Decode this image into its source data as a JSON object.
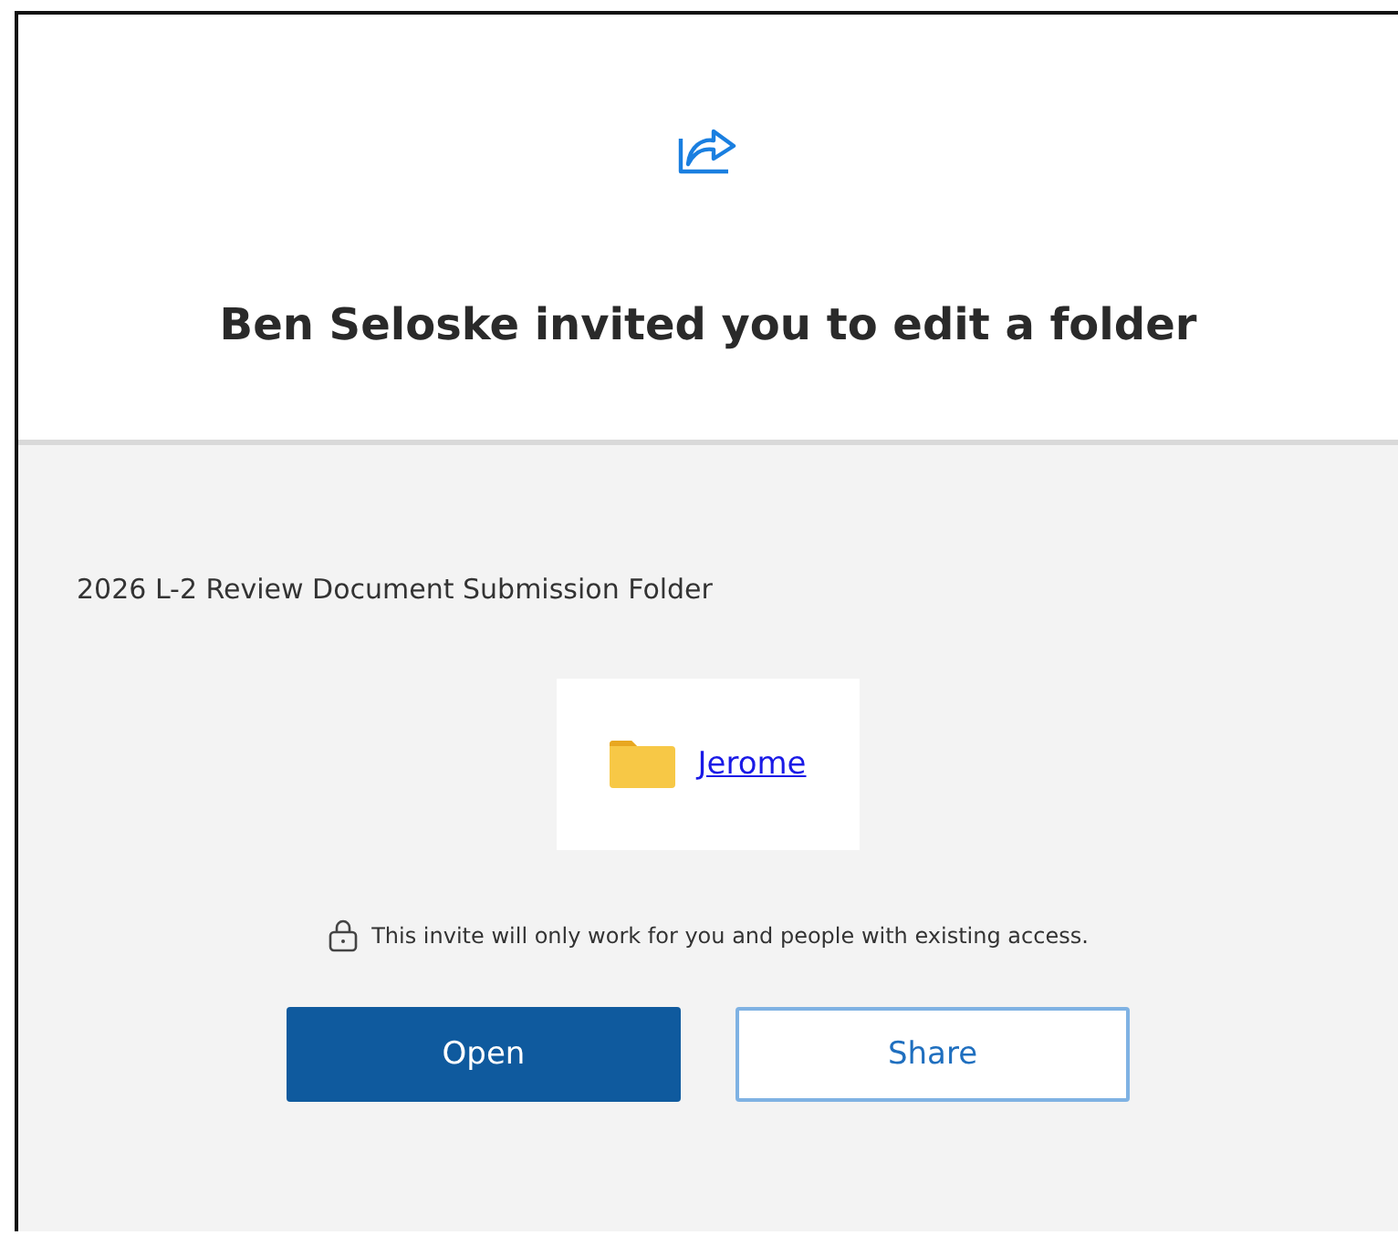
{
  "header": {
    "title": "Ben Seloske invited you to edit a folder"
  },
  "body": {
    "folder_path": "2026 L-2 Review Document Submission Folder",
    "item": {
      "name": "Jerome"
    },
    "notice": "This invite will only work for you and people with existing access.",
    "buttons": [
      {
        "label": "Open",
        "kind": "primary"
      },
      {
        "label": "Share",
        "kind": "secondary"
      }
    ]
  }
}
